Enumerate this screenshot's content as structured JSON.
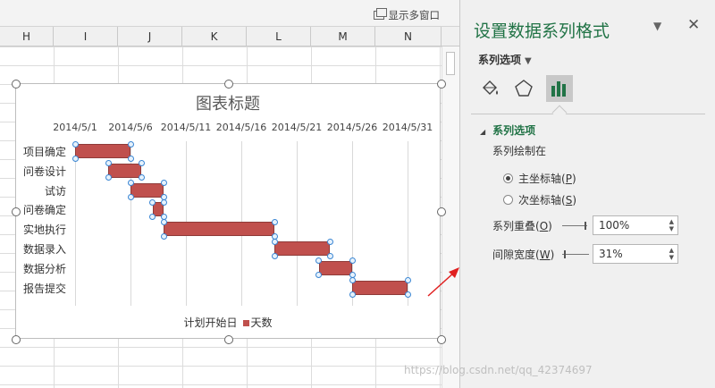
{
  "topbar": {
    "multi_window_label": "显示多窗口"
  },
  "columns": [
    "H",
    "I",
    "J",
    "K",
    "L",
    "M",
    "N"
  ],
  "chart": {
    "title": "图表标题"
  },
  "chart_data": {
    "type": "bar",
    "title": "图表标题",
    "orientation": "horizontal",
    "stacked": true,
    "x_tick_labels": [
      "2014/5/1",
      "2014/5/6",
      "2014/5/11",
      "2014/5/16",
      "2014/5/21",
      "2014/5/26",
      "2014/5/31"
    ],
    "categories": [
      "项目确定",
      "问卷设计",
      "试访",
      "问卷确定",
      "实地执行",
      "数据录入",
      "数据分析",
      "报告提交"
    ],
    "series": [
      {
        "name": "计划开始日",
        "values": [
          "2014/5/1",
          "2014/5/4",
          "2014/5/6",
          "2014/5/8",
          "2014/5/9",
          "2014/5/19",
          "2014/5/23",
          "2014/5/26"
        ],
        "visible": false
      },
      {
        "name": "天数",
        "values": [
          5,
          3,
          3,
          1,
          10,
          5,
          3,
          5
        ],
        "color": "#c0504d"
      }
    ],
    "legend": [
      "计划开始日",
      "天数"
    ],
    "legend_position": "bottom",
    "grid": "vertical"
  },
  "annotation": {
    "arrow_color": "#e02020"
  },
  "pane": {
    "title": "设置数据系列格式",
    "menu_icon": "chevron-down-icon",
    "close_icon": "close-icon",
    "series_options_label": "系列选项",
    "tabs": [
      "paint-bucket-icon",
      "pentagon-icon",
      "bar-chart-icon"
    ],
    "section_title": "系列选项",
    "plot_on_label": "系列绘制在",
    "primary_axis": {
      "label": "主坐标轴",
      "key": "P",
      "selected": true
    },
    "secondary_axis": {
      "label": "次坐标轴",
      "key": "S",
      "selected": false
    },
    "overlap": {
      "label": "系列重叠",
      "key": "O",
      "value": "100%"
    },
    "gap": {
      "label": "间隙宽度",
      "key": "W",
      "value": "31%"
    }
  },
  "watermark": "https://blog.csdn.net/qq_42374697",
  "accent_color": "#217346"
}
